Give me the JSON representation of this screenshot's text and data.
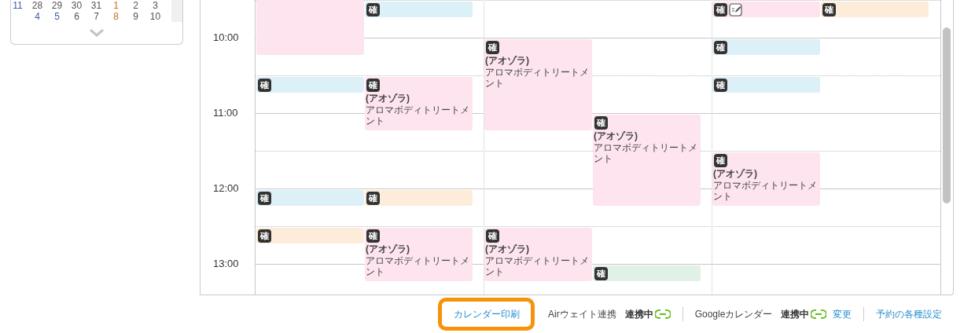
{
  "mini_calendar": {
    "weeks": [
      {
        "week": "11",
        "days": [
          {
            "text": "28",
            "color": "#555555"
          },
          {
            "text": "29",
            "color": "#555555"
          },
          {
            "text": "30",
            "color": "#555555"
          },
          {
            "text": "31",
            "color": "#555555"
          },
          {
            "text": "1",
            "color": "#c0701c"
          },
          {
            "text": "2",
            "color": "#555555"
          },
          {
            "text": "3",
            "color": "#555555"
          }
        ]
      },
      {
        "days": [
          {
            "text": "4",
            "color": "#3f5fa8"
          },
          {
            "text": "5",
            "color": "#3f5fa8"
          },
          {
            "text": "6",
            "color": "#555555"
          },
          {
            "text": "7",
            "color": "#555555"
          },
          {
            "text": "8",
            "color": "#c0701c"
          },
          {
            "text": "9",
            "color": "#555555"
          },
          {
            "text": "10",
            "color": "#555555"
          }
        ]
      }
    ]
  },
  "time_labels": [
    "10:00",
    "11:00",
    "12:00",
    "13:00"
  ],
  "lanes": [
    {
      "slots": [
        {
          "kind": "start",
          "color": "#fde4ee"
        },
        {
          "kind": "cont"
        },
        {
          "kind": "cont"
        },
        {
          "kind": "cont"
        },
        {
          "kind": "cont"
        },
        {
          "kind": "empty"
        },
        {
          "kind": "start",
          "color": "#dcf0f8",
          "badge": "確"
        },
        {
          "kind": "empty"
        },
        {
          "kind": "empty"
        },
        {
          "kind": "empty"
        },
        {
          "kind": "empty"
        },
        {
          "kind": "empty"
        },
        {
          "kind": "start",
          "color": "#dcf0f8",
          "badge": "確"
        },
        {
          "kind": "empty"
        },
        {
          "kind": "start",
          "color": "#fdecd9",
          "badge": "確"
        }
      ]
    },
    {
      "slots": [
        {
          "kind": "empty"
        },
        {
          "kind": "empty"
        },
        {
          "kind": "start",
          "color": "#dcf0f8",
          "badge": "確"
        },
        {
          "kind": "empty"
        },
        {
          "kind": "empty"
        },
        {
          "kind": "empty"
        },
        {
          "kind": "start",
          "color": "#fde4ee",
          "badge": "確",
          "name": "(アオゾラ)",
          "service": "アロマボディトリートメント"
        },
        {
          "kind": "cont"
        },
        {
          "kind": "cont"
        },
        {
          "kind": "empty"
        },
        {
          "kind": "empty"
        },
        {
          "kind": "empty"
        },
        {
          "kind": "start",
          "color": "#fdecd9",
          "badge": "確"
        },
        {
          "kind": "empty"
        },
        {
          "kind": "start",
          "color": "#fde4ee",
          "badge": "確",
          "name": "(アオゾラ)",
          "service": "アロマボディトリートメント"
        },
        {
          "kind": "cont"
        },
        {
          "kind": "cont"
        }
      ]
    },
    {
      "slots": [
        {
          "kind": "empty"
        },
        {
          "kind": "empty"
        },
        {
          "kind": "empty"
        },
        {
          "kind": "empty"
        },
        {
          "kind": "start",
          "color": "#fde4ee",
          "badge": "確",
          "name": "(アオゾラ)",
          "service": "アロマボディトリートメント"
        },
        {
          "kind": "cont"
        },
        {
          "kind": "cont"
        },
        {
          "kind": "cont"
        },
        {
          "kind": "cont"
        },
        {
          "kind": "empty"
        },
        {
          "kind": "empty"
        },
        {
          "kind": "empty"
        },
        {
          "kind": "empty"
        },
        {
          "kind": "empty"
        },
        {
          "kind": "start",
          "color": "#fde4ee",
          "badge": "確",
          "name": "(アオゾラ)",
          "service": "アロマボディトリートメント"
        },
        {
          "kind": "cont"
        },
        {
          "kind": "cont"
        }
      ]
    },
    {
      "slots": [
        {
          "kind": "empty"
        },
        {
          "kind": "empty"
        },
        {
          "kind": "empty"
        },
        {
          "kind": "empty"
        },
        {
          "kind": "empty"
        },
        {
          "kind": "empty"
        },
        {
          "kind": "empty"
        },
        {
          "kind": "empty"
        },
        {
          "kind": "start",
          "color": "#fde4ee",
          "badge": "確",
          "name": "(アオゾラ)",
          "service": "アロマボディトリートメント"
        },
        {
          "kind": "cont"
        },
        {
          "kind": "cont"
        },
        {
          "kind": "cont"
        },
        {
          "kind": "cont"
        },
        {
          "kind": "empty"
        },
        {
          "kind": "empty"
        },
        {
          "kind": "empty"
        },
        {
          "kind": "start",
          "color": "#e0f1e8",
          "badge": "確"
        }
      ]
    },
    {
      "slots": [
        {
          "kind": "empty"
        },
        {
          "kind": "empty"
        },
        {
          "kind": "start",
          "color": "#fde4ee",
          "badge": "確",
          "memo": true
        },
        {
          "kind": "empty"
        },
        {
          "kind": "start",
          "color": "#dcf0f8",
          "badge": "確"
        },
        {
          "kind": "empty"
        },
        {
          "kind": "start",
          "color": "#dcf0f8",
          "badge": "確"
        },
        {
          "kind": "empty"
        },
        {
          "kind": "empty"
        },
        {
          "kind": "empty"
        },
        {
          "kind": "start",
          "color": "#fde4ee",
          "badge": "確",
          "name": "(アオゾラ)",
          "service": "アロマボディトリートメント"
        },
        {
          "kind": "cont"
        },
        {
          "kind": "cont"
        }
      ]
    },
    {
      "slots": [
        {
          "kind": "empty"
        },
        {
          "kind": "empty"
        },
        {
          "kind": "start",
          "color": "#fdecd9",
          "badge": "確"
        }
      ]
    }
  ],
  "footer": {
    "print_button": "カレンダー印刷",
    "integrations": [
      {
        "name": "Airウェイト連携",
        "status": "連携中",
        "connected": true
      },
      {
        "name": "Googleカレンダー",
        "status": "連携中",
        "connected": true,
        "action": "変更"
      }
    ],
    "settings_link": "予約の各種設定"
  }
}
